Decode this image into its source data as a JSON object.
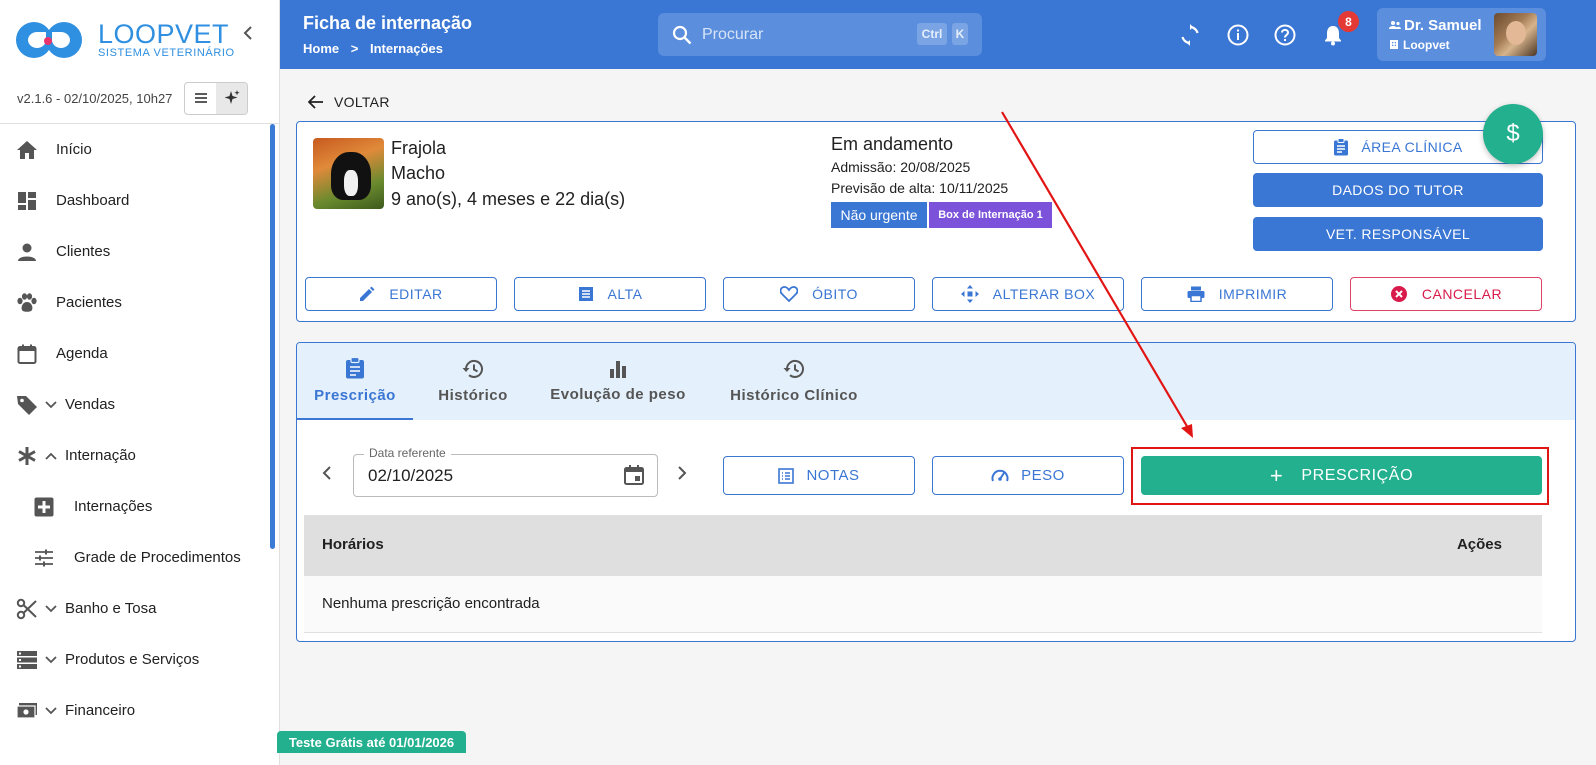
{
  "brand": {
    "name": "LOOPVET",
    "subtitle": "SISTEMA VETERINÁRIO",
    "version": "v2.1.6 - 02/10/2025, 10h27"
  },
  "sidebar": {
    "items": [
      {
        "label": "Início",
        "icon": "home-icon"
      },
      {
        "label": "Dashboard",
        "icon": "dashboard-icon"
      },
      {
        "label": "Clientes",
        "icon": "person-icon"
      },
      {
        "label": "Pacientes",
        "icon": "paw-icon"
      },
      {
        "label": "Agenda",
        "icon": "calendar-icon"
      },
      {
        "label": "Vendas",
        "icon": "tag-icon",
        "expandable": true
      },
      {
        "label": "Internação",
        "icon": "asterisk-icon",
        "expanded": true
      },
      {
        "label": "Internações",
        "icon": "medical-cross-icon",
        "sub": true
      },
      {
        "label": "Grade de Procedimentos",
        "icon": "sliders-icon",
        "sub": true
      },
      {
        "label": "Banho e Tosa",
        "icon": "scissors-icon",
        "expandable": true
      },
      {
        "label": "Produtos e Serviços",
        "icon": "storage-icon",
        "expandable": true
      },
      {
        "label": "Financeiro",
        "icon": "money-icon",
        "expandable": true
      }
    ]
  },
  "header": {
    "title": "Ficha de internação",
    "breadcrumb": [
      "Home",
      ">",
      "Internações"
    ],
    "search_placeholder": "Procurar",
    "shortcut": [
      "Ctrl",
      "K"
    ],
    "notifications": "8",
    "user": {
      "name": "Dr. Samuel",
      "org": "Loopvet"
    }
  },
  "back_label": "VOLTAR",
  "patient": {
    "name": "Frajola",
    "sex": "Macho",
    "age": "9 ano(s), 4 meses e 22 dia(s)",
    "status": "Em andamento",
    "admission": "Admissão: 20/08/2025",
    "discharge_forecast": "Previsão de alta: 10/11/2025",
    "urgency": "Não urgente",
    "box": "Box de Internação 1"
  },
  "side_buttons": {
    "clinical_area": "ÁREA CLÍNICA",
    "tutor_data": "DADOS DO TUTOR",
    "vet_responsible": "VET. RESPONSÁVEL",
    "fab": "$"
  },
  "actions": {
    "edit": "EDITAR",
    "discharge": "ALTA",
    "death": "ÓBITO",
    "change_box": "ALTERAR BOX",
    "print": "IMPRIMIR",
    "cancel": "CANCELAR"
  },
  "tabs": [
    {
      "label": "Prescrição",
      "icon": "clipboard-icon",
      "active": true
    },
    {
      "label": "Histórico",
      "icon": "history-icon"
    },
    {
      "label": "Evolução de peso",
      "icon": "bar-chart-icon"
    },
    {
      "label": "Histórico Clínico",
      "icon": "history-icon"
    }
  ],
  "prescription": {
    "date_label": "Data referente",
    "date_value": "02/10/2025",
    "notes_label": "NOTAS",
    "weight_label": "PESO",
    "add_label": "PRESCRIÇÃO",
    "table_headers": {
      "hours": "Horários",
      "actions": "Ações"
    },
    "empty": "Nenhuma prescrição encontrada"
  },
  "trial_banner": "Teste Grátis até 01/01/2026",
  "colors": {
    "primary": "#3a76d3",
    "success": "#22b08e",
    "danger": "#d81b4a",
    "annotation": "#e21515",
    "box_tag": "#7b52d9"
  }
}
